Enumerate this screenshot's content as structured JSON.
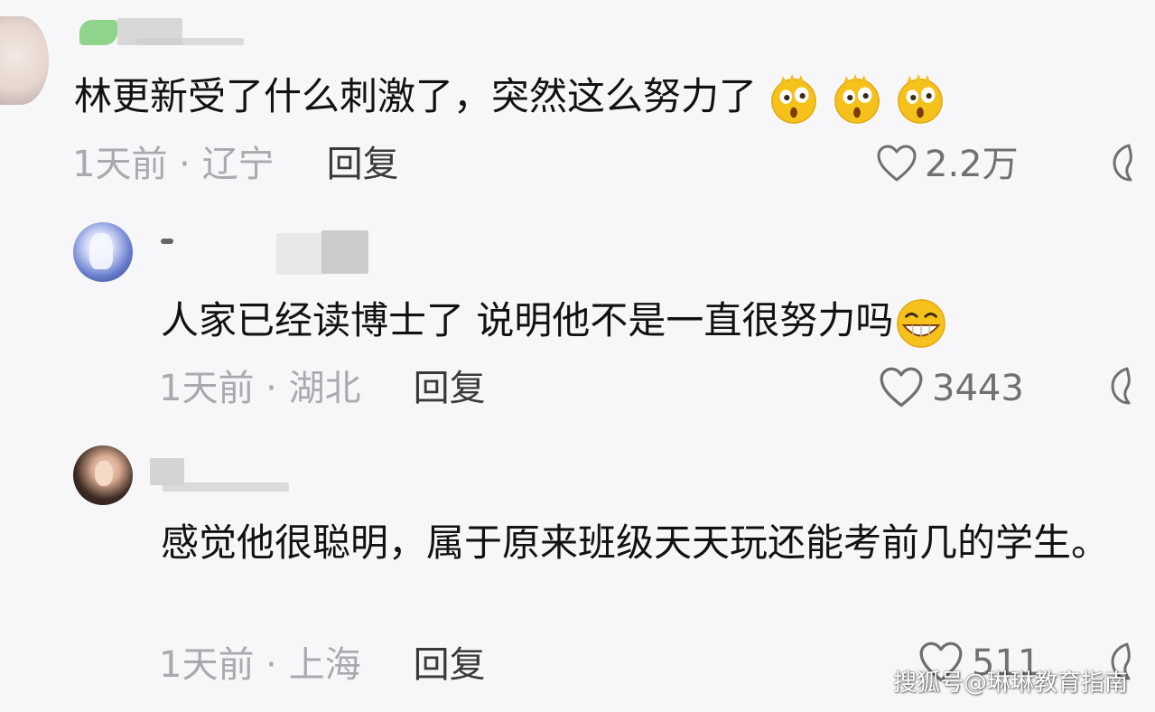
{
  "comments": [
    {
      "text": "林更新受了什么刺激了，突然这么努力了",
      "emojis": [
        "surprised-face-emoji",
        "surprised-face-emoji",
        "surprised-face-emoji"
      ],
      "time_location": "1天前 · 辽宁",
      "reply_label": "回复",
      "likes": "2.2万"
    },
    {
      "text": "人家已经读博士了 说明他不是一直很努力吗",
      "emojis": [
        "grinning-face-emoji"
      ],
      "time_location": "1天前 · 湖北",
      "reply_label": "回复",
      "likes": "3443"
    },
    {
      "text": "感觉他很聪明，属于原来班级天天玩还能考前几的学生。",
      "emojis": [],
      "time_location": "1天前 · 上海",
      "reply_label": "回复",
      "likes": "511"
    }
  ],
  "watermark": "搜狐号@琳琳教育指南",
  "colors": {
    "background": "#f7f7f9",
    "text": "#121212",
    "meta": "#a9aab0",
    "reply": "#3a3a3d",
    "emoji_yellow": "#f6c11b"
  }
}
